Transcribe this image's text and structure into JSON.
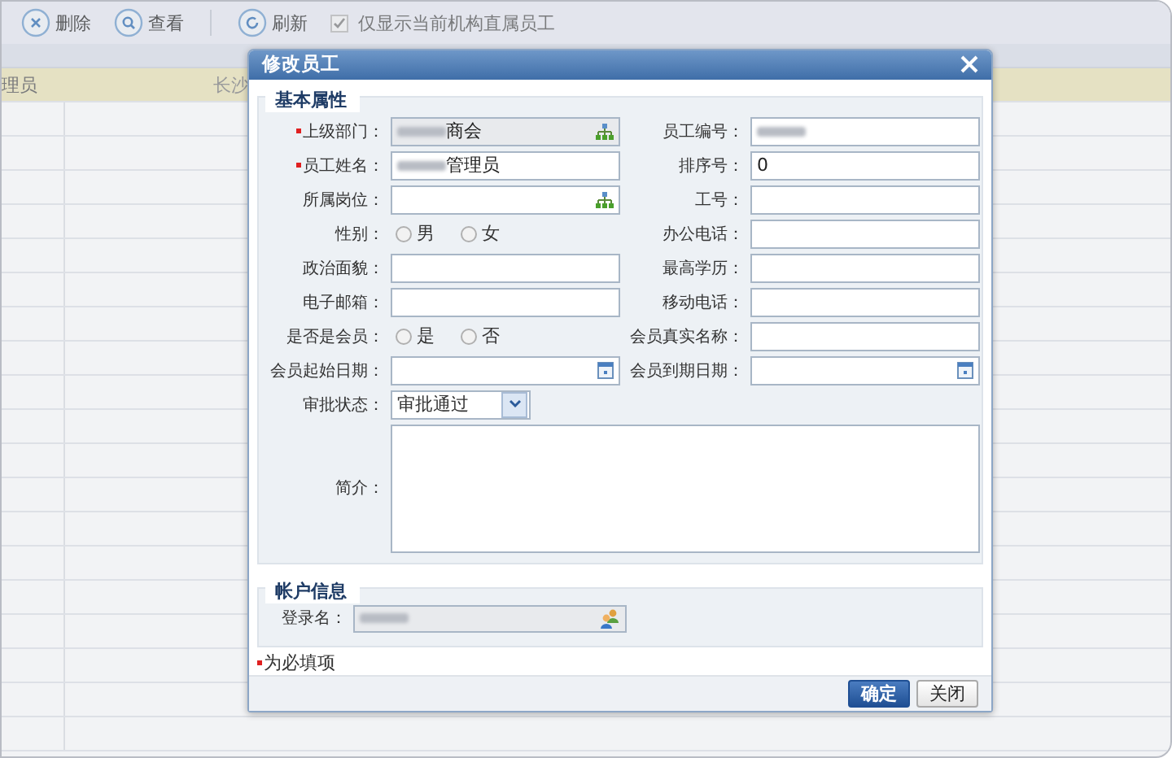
{
  "toolbar": {
    "buttons": [
      {
        "label": "删除",
        "kind": "delete"
      },
      {
        "label": "查看",
        "kind": "view"
      },
      {
        "label": "刷新",
        "kind": "refresh"
      }
    ],
    "filter": {
      "label": "仅显示当前机构直属员工",
      "checked": true
    }
  },
  "grid": {
    "selected_row": {
      "column_1": "理员",
      "column_2": "长沙"
    }
  },
  "dialog": {
    "title": "修改员工",
    "basic": {
      "legend": "基本属性",
      "rows": [
        [
          {
            "label": "上级部门：",
            "required": true,
            "kind": "picker",
            "value": "商会",
            "redacted": true,
            "readonly": true
          },
          {
            "label": "员工编号：",
            "required": false,
            "kind": "text",
            "redacted": true,
            "readonly": false
          }
        ],
        [
          {
            "label": "员工姓名：",
            "required": true,
            "kind": "text",
            "value": "管理员",
            "redacted": true,
            "readonly": false
          },
          {
            "label": "排序号：",
            "required": false,
            "kind": "text",
            "value": "0",
            "redacted": false,
            "readonly": false
          }
        ],
        [
          {
            "label": "所属岗位：",
            "required": false,
            "kind": "picker",
            "redacted": false,
            "readonly": false
          },
          {
            "label": "工号：",
            "required": false,
            "kind": "text",
            "redacted": false,
            "readonly": false
          }
        ],
        [
          {
            "label": "性别：",
            "required": false,
            "kind": "radio",
            "options": [
              {
                "label": "男",
                "selected": false
              },
              {
                "label": "女",
                "selected": false
              }
            ]
          },
          {
            "label": "办公电话：",
            "required": false,
            "kind": "text",
            "redacted": false,
            "readonly": false
          }
        ],
        [
          {
            "label": "政治面貌：",
            "required": false,
            "kind": "text",
            "redacted": false,
            "readonly": false
          },
          {
            "label": "最高学历：",
            "required": false,
            "kind": "text",
            "redacted": false,
            "readonly": false
          }
        ],
        [
          {
            "label": "电子邮箱：",
            "required": false,
            "kind": "text",
            "redacted": false,
            "readonly": false
          },
          {
            "label": "移动电话：",
            "required": false,
            "kind": "text",
            "redacted": false,
            "readonly": false
          }
        ],
        [
          {
            "label": "是否是会员：",
            "required": false,
            "kind": "radio",
            "options": [
              {
                "label": "是",
                "selected": false
              },
              {
                "label": "否",
                "selected": false
              }
            ]
          },
          {
            "label": "会员真实名称：",
            "required": false,
            "kind": "text",
            "redacted": false,
            "readonly": false
          }
        ],
        [
          {
            "label": "会员起始日期：",
            "required": false,
            "kind": "date",
            "redacted": false,
            "readonly": false
          },
          {
            "label": "会员到期日期：",
            "required": false,
            "kind": "date",
            "redacted": false,
            "readonly": false
          }
        ],
        [
          {
            "label": "审批状态：",
            "required": false,
            "kind": "select",
            "value": "审批通过"
          }
        ],
        [
          {
            "label": "简介：",
            "required": false,
            "kind": "textarea"
          }
        ]
      ]
    },
    "account": {
      "legend": "帐户信息",
      "login": {
        "label": "登录名：",
        "redacted": true,
        "readonly": true
      }
    },
    "required_note": "为必填项",
    "buttons": [
      {
        "label": "确定",
        "primary": true
      },
      {
        "label": "关闭",
        "primary": false
      }
    ]
  }
}
